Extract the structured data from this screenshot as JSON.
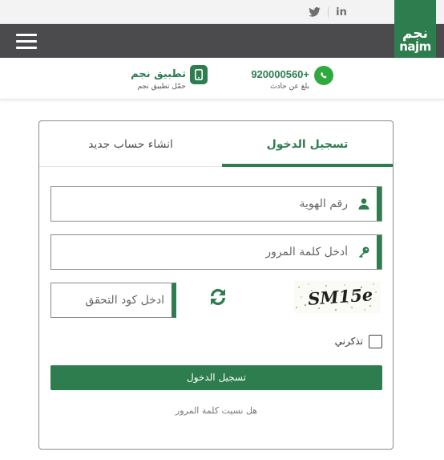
{
  "social": {
    "twitter_icon": "twitter-icon",
    "linkedin_label": "in"
  },
  "header": {
    "menu_icon": "hamburger-menu-icon",
    "logo_ar": "نجم",
    "logo_en": "najm"
  },
  "info": {
    "phone_number": "920000560+",
    "phone_caption": "بلغ عن حادث",
    "app_title": "تطبيق نجم",
    "app_caption": "حمّل تطبيق نجم"
  },
  "login_card": {
    "tab_login": "تسجيل الدخول",
    "tab_register": "انشاء حساب جديد",
    "id_placeholder": "رقم الهوية",
    "password_placeholder": "أدخل كلمة المرور",
    "captcha_placeholder": "ادخل كود التحقق",
    "captcha_text": "SM15e",
    "remember_label": "تذكرني",
    "login_button": "تسجيل الدخول",
    "forgot_password": "هل نسيت كلمة المرور"
  },
  "colors": {
    "brand_green": "#2e7d4f",
    "header_gray": "#4b4b4d",
    "whatsapp_green": "#2faa3f"
  }
}
